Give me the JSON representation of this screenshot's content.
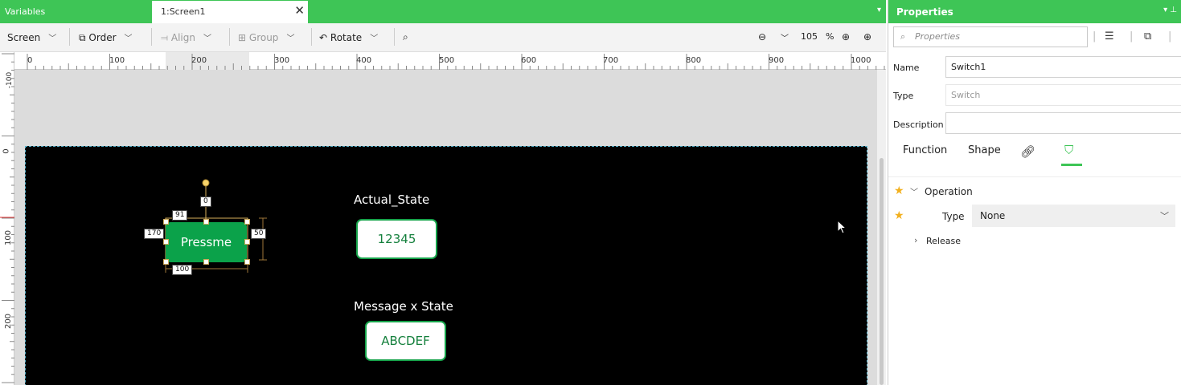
{
  "tabs": {
    "variables": "Variables",
    "screen": "1:Screen1",
    "close": "✕",
    "menu": "▾"
  },
  "toolbar": {
    "screen": "Screen",
    "order": "Order",
    "align": "Align",
    "group": "Group",
    "rotate": "Rotate",
    "zoom_value": "105",
    "zoom_unit": "%"
  },
  "ruler_h": [
    "0",
    "100",
    "200",
    "300",
    "400",
    "500",
    "600",
    "700",
    "800",
    "900",
    "1000"
  ],
  "ruler_v": [
    "-100",
    "0",
    "100",
    "200"
  ],
  "canvas": {
    "switch_label": "Pressme",
    "tag_rotate": "0",
    "tag_y": "91",
    "tag_x": "170",
    "tag_h": "50",
    "tag_w": "100",
    "actual_state_label": "Actual_State",
    "actual_state_value": "12345",
    "message_label": "Message x State",
    "message_value": "ABCDEF"
  },
  "properties": {
    "title": "Properties",
    "search_placeholder": "Properties",
    "name_label": "Name",
    "name_value": "Switch1",
    "type_label": "Type",
    "type_value": "Switch",
    "description_label": "Description",
    "description_value": "",
    "tab_function": "Function",
    "tab_shape": "Shape",
    "operation": "Operation",
    "op_type_label": "Type",
    "op_type_value": "None",
    "release": "Release"
  },
  "colors": {
    "brand_green": "#3ec556",
    "switch_green": "#0ba24a",
    "value_green": "#15803d"
  }
}
